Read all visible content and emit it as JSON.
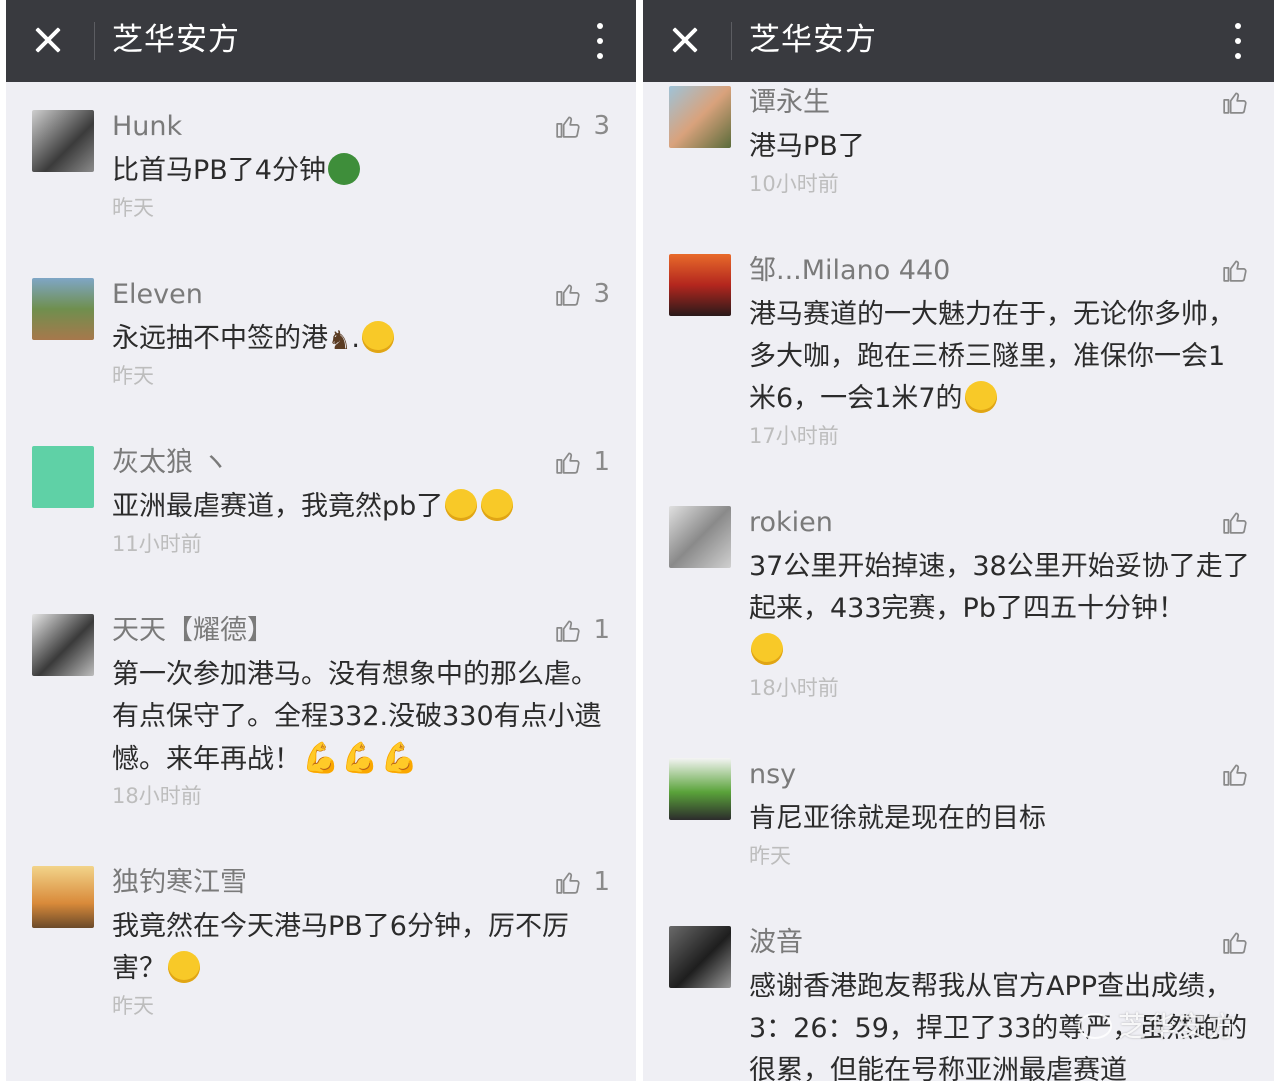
{
  "left": {
    "title": "芝华安方",
    "comments": [
      {
        "name": "Hunk",
        "text": "比首马PB了4分钟",
        "time": "昨天",
        "likes": "3"
      },
      {
        "name": "Eleven",
        "text": "永远抽不中签的港",
        "text_suffix": ".",
        "time": "昨天",
        "likes": "3"
      },
      {
        "name": "灰太狼 ヽ",
        "text": "亚洲最虐赛道，我竟然pb了",
        "time": "11小时前",
        "likes": "1"
      },
      {
        "name": "天天【耀德】",
        "text": "第一次参加港马。没有想象中的那么虐。有点保守了。全程332.没破330有点小遗憾。来年再战！",
        "time": "18小时前",
        "likes": "1"
      },
      {
        "name": "独钓寒江雪",
        "text": "我竟然在今天港马PB了6分钟，厉不厉害？",
        "time": "昨天",
        "likes": "1"
      }
    ]
  },
  "right": {
    "title": "芝华安方",
    "comments": [
      {
        "name": "谭永生",
        "text": "港马PB了",
        "time": "10小时前",
        "likes": ""
      },
      {
        "name": "邹...Milano 440",
        "text": "港马赛道的一大魅力在于，无论你多帅，多大咖，跑在三桥三隧里，准保你一会1米6，一会1米7的",
        "time": "17小时前",
        "likes": ""
      },
      {
        "name": "rokien",
        "text": "37公里开始掉速，38公里开始妥协了走了起来，433完赛，Pb了四五十分钟！",
        "time": "18小时前",
        "likes": ""
      },
      {
        "name": "nsy",
        "text": "肯尼亚徐就是现在的目标",
        "time": "昨天",
        "likes": ""
      },
      {
        "name": "波音",
        "text": "感谢香港跑友帮我从官方APP查出成绩，3：26：59，捍卫了33的尊严，虽然跑的很累，但能在号称亚洲最虐赛道",
        "time": "",
        "likes": ""
      }
    ]
  },
  "watermark": "芝华安方",
  "colors": {
    "topbar": "#393a3f",
    "background": "#efeff4"
  }
}
